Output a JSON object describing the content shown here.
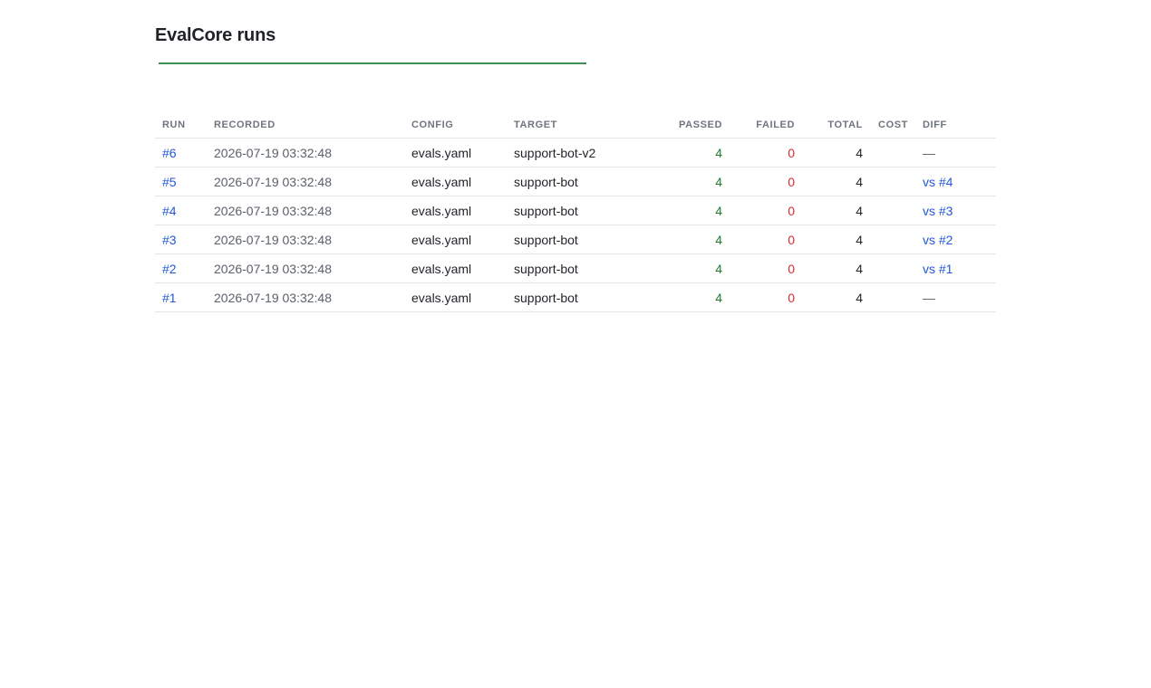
{
  "page": {
    "title": "EvalCore runs",
    "accent_color": "#3f8f52"
  },
  "table": {
    "columns": [
      "RUN",
      "RECORDED",
      "CONFIG",
      "TARGET",
      "PASSED",
      "FAILED",
      "TOTAL",
      "COST",
      "DIFF"
    ],
    "rows": [
      {
        "run": "#6",
        "recorded": "2026-07-19 03:32:48",
        "config": "evals.yaml",
        "target": "support-bot-v2",
        "passed": "4",
        "failed": "0",
        "total": "4",
        "cost": "",
        "diff": "—",
        "diff_is_link": false
      },
      {
        "run": "#5",
        "recorded": "2026-07-19 03:32:48",
        "config": "evals.yaml",
        "target": "support-bot",
        "passed": "4",
        "failed": "0",
        "total": "4",
        "cost": "",
        "diff": "vs #4",
        "diff_is_link": true
      },
      {
        "run": "#4",
        "recorded": "2026-07-19 03:32:48",
        "config": "evals.yaml",
        "target": "support-bot",
        "passed": "4",
        "failed": "0",
        "total": "4",
        "cost": "",
        "diff": "vs #3",
        "diff_is_link": true
      },
      {
        "run": "#3",
        "recorded": "2026-07-19 03:32:48",
        "config": "evals.yaml",
        "target": "support-bot",
        "passed": "4",
        "failed": "0",
        "total": "4",
        "cost": "",
        "diff": "vs #2",
        "diff_is_link": true
      },
      {
        "run": "#2",
        "recorded": "2026-07-19 03:32:48",
        "config": "evals.yaml",
        "target": "support-bot",
        "passed": "4",
        "failed": "0",
        "total": "4",
        "cost": "",
        "diff": "vs #1",
        "diff_is_link": true
      },
      {
        "run": "#1",
        "recorded": "2026-07-19 03:32:48",
        "config": "evals.yaml",
        "target": "support-bot",
        "passed": "4",
        "failed": "0",
        "total": "4",
        "cost": "",
        "diff": "—",
        "diff_is_link": false
      }
    ]
  }
}
